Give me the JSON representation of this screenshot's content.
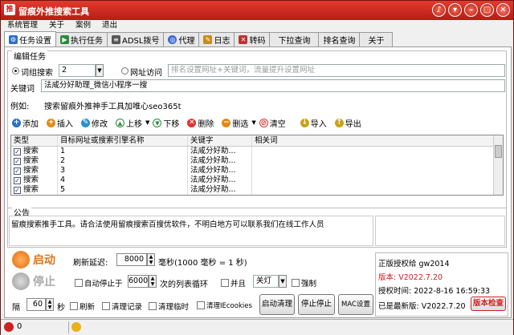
{
  "window": {
    "title": "留痕外推搜索工具"
  },
  "menu": [
    "系统管理",
    "关于",
    "案例",
    "退出"
  ],
  "tabs": [
    {
      "label": "任务设置",
      "icon": "gear-icon",
      "color": "#2a6fc9"
    },
    {
      "label": "执行任务",
      "icon": "play-icon",
      "color": "#2a8c3a"
    },
    {
      "label": "ADSL拨号",
      "icon": "modem-icon",
      "color": "#555"
    },
    {
      "label": "代理",
      "icon": "globe-icon",
      "color": "#3a6ad0"
    },
    {
      "label": "日志",
      "icon": "note-icon",
      "color": "#c98a1a"
    },
    {
      "label": "转码",
      "icon": "tools-icon",
      "color": "#b33"
    },
    {
      "label": "下拉查询",
      "icon": "",
      "color": ""
    },
    {
      "label": "排名查询",
      "icon": "",
      "color": ""
    },
    {
      "label": "关于",
      "icon": "",
      "color": ""
    }
  ],
  "task": {
    "legend": "编辑任务",
    "mode_group": "词组搜索",
    "group_value": "2",
    "mode_url": "网址访问",
    "url_placeholder": "排名设置网址+关键词，流量提升设置网址",
    "keyword_label": "关键词",
    "keyword_value": "法咸分好助理_微信小程序一搜",
    "example_label": "例如:",
    "example_value": "搜索留痕外推神手工具加唯心seo365t"
  },
  "toolbar": [
    {
      "label": "添加",
      "icon": "add-icon",
      "color": "#2a6fc9",
      "glyph": "+"
    },
    {
      "label": "插入",
      "icon": "insert-icon",
      "color": "#e08a18",
      "glyph": "+"
    },
    {
      "label": "修改",
      "icon": "edit-icon",
      "color": "#2a8fd0",
      "glyph": "✎"
    },
    {
      "label": "上移",
      "icon": "up-icon",
      "color": "#2a8c3a",
      "glyph": "▲"
    },
    {
      "label": "下移",
      "icon": "down-icon",
      "color": "#2a8c3a",
      "glyph": "▼"
    },
    {
      "label": "删除",
      "icon": "delete-icon",
      "color": "#d33",
      "glyph": "✕"
    },
    {
      "label": "删选",
      "icon": "filter-icon",
      "color": "#e08a18",
      "glyph": "−"
    },
    {
      "label": "清空",
      "icon": "clear-icon",
      "color": "#d33",
      "glyph": "⊘"
    },
    {
      "label": "导入",
      "icon": "import-icon",
      "color": "#c9a21a",
      "glyph": "↓"
    },
    {
      "label": "导出",
      "icon": "export-icon",
      "color": "#c9a21a",
      "glyph": "↑"
    }
  ],
  "table": {
    "headers": [
      "类型",
      "目标网址或搜索引擎名称",
      "关键字",
      "相关词"
    ],
    "rows": [
      {
        "type": "搜索",
        "target": "1",
        "keyword": "法咸分好助...",
        "related": ""
      },
      {
        "type": "搜索",
        "target": "2",
        "keyword": "法咸分好助...",
        "related": ""
      },
      {
        "type": "搜索",
        "target": "3",
        "keyword": "法咸分好助...",
        "related": ""
      },
      {
        "type": "搜索",
        "target": "4",
        "keyword": "法咸分好助...",
        "related": ""
      },
      {
        "type": "搜索",
        "target": "5",
        "keyword": "法咸分好助...",
        "related": ""
      }
    ]
  },
  "notice": {
    "legend": "公告",
    "text": "留痕搜索推手工具。请合法使用留痕搜索百搜优软件，不明白地方可以联系我们在线工作人员"
  },
  "controls": {
    "start": "启动",
    "stop": "停止",
    "refresh_label": "刷新延迟:",
    "refresh_value": "8000",
    "refresh_unit": "毫秒(1000 毫秒 = 1 秒)",
    "autostop_label": "自动停止于",
    "autostop_value": "6000",
    "autostop_unit": "次的列表循环",
    "and_label": "并且",
    "and_select": "关灯",
    "force_label": "强制",
    "interval_label": "隔",
    "interval_value": "60",
    "interval_unit": "秒",
    "opt_refresh": "刷新",
    "opt_clear_records": "清理记录",
    "opt_clear_temp": "清理临时",
    "opt_clear_cookies": "清理IEcookies",
    "btn_start_clean": "启动清理",
    "btn_stop": "停止停止",
    "btn_mac": "MAC设置"
  },
  "info": {
    "licensed": "正版授权给 gw2014",
    "version": "版本: V2022.7.20",
    "auth_time": "授权时间: 2022-8-16 16:59:33",
    "latest": "已是最新版: V2022.7.20",
    "check_btn": "版本检查"
  },
  "status": {
    "left_value": "0",
    "right_value": "0"
  }
}
